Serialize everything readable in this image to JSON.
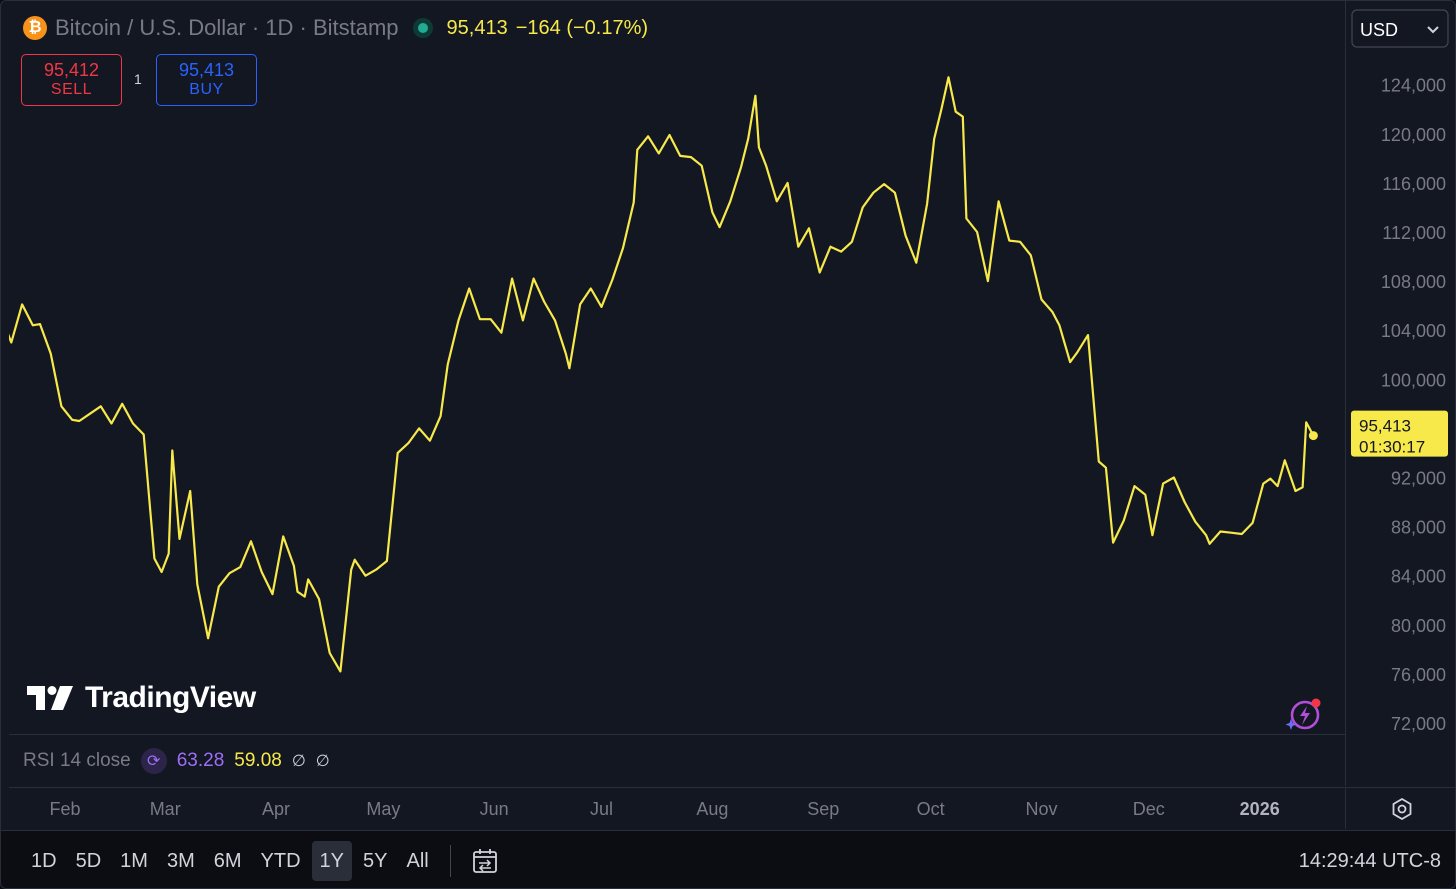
{
  "header": {
    "symbol_icon": "bitcoin-icon",
    "title": "Bitcoin / U.S. Dollar · 1D · Bitstamp",
    "last_price": "95,413",
    "change": "−164 (−0.17%)"
  },
  "trade": {
    "sell_price": "95,412",
    "sell_label": "SELL",
    "spread": "1",
    "buy_price": "95,413",
    "buy_label": "BUY"
  },
  "currency_select": {
    "value": "USD",
    "options": [
      "USD"
    ]
  },
  "price_badge": {
    "price": "95,413",
    "countdown": "01:30:17"
  },
  "brand": {
    "name": "TradingView"
  },
  "rsi": {
    "label": "RSI 14 close",
    "value1": "63.28",
    "value2": "59.08",
    "null1": "∅",
    "null2": "∅"
  },
  "time_axis": {
    "labels": [
      "Feb",
      "Mar",
      "Apr",
      "May",
      "Jun",
      "Jul",
      "Aug",
      "Sep",
      "Oct",
      "Nov",
      "Dec",
      "2026"
    ]
  },
  "bottom_bar": {
    "ranges": [
      "1D",
      "5D",
      "1M",
      "3M",
      "6M",
      "YTD",
      "1Y",
      "5Y",
      "All"
    ],
    "active_range": "1Y",
    "clock": "14:29:44 UTC-8"
  },
  "colors": {
    "line": "#f7e94a",
    "sell": "#f23645",
    "buy": "#2962ff",
    "rsi_primary": "#9c6ff5",
    "background": "#131722"
  },
  "chart_data": {
    "type": "line",
    "title": "Bitcoin / U.S. Dollar · 1D · Bitstamp",
    "xlabel": "",
    "ylabel": "",
    "ylim": [
      70000,
      128500
    ],
    "yticks": [
      72000,
      76000,
      80000,
      84000,
      88000,
      92000,
      100000,
      104000,
      108000,
      112000,
      116000,
      120000,
      124000
    ],
    "ytick_labels": [
      "72,000",
      "76,000",
      "80,000",
      "84,000",
      "88,000",
      "92,000",
      "100,000",
      "104,000",
      "108,000",
      "112,000",
      "116,000",
      "120,000",
      "124,000"
    ],
    "x_axis_dates": [
      "2025-02-01",
      "2025-03-01",
      "2025-04-01",
      "2025-05-01",
      "2025-06-01",
      "2025-07-01",
      "2025-08-01",
      "2025-09-01",
      "2025-10-01",
      "2025-11-01",
      "2025-12-01",
      "2026-01-01"
    ],
    "series": [
      {
        "x": [
          "2025-01-14",
          "2025-01-15",
          "2025-01-17",
          "2025-01-20",
          "2025-01-23",
          "2025-01-25",
          "2025-01-28",
          "2025-01-31",
          "2025-02-03",
          "2025-02-05",
          "2025-02-08",
          "2025-02-11",
          "2025-02-14",
          "2025-02-17",
          "2025-02-20",
          "2025-02-23",
          "2025-02-26",
          "2025-02-28",
          "2025-03-02",
          "2025-03-03",
          "2025-03-05",
          "2025-03-08",
          "2025-03-10",
          "2025-03-13",
          "2025-03-16",
          "2025-03-19",
          "2025-03-22",
          "2025-03-25",
          "2025-03-28",
          "2025-03-31",
          "2025-04-03",
          "2025-04-06",
          "2025-04-07",
          "2025-04-09",
          "2025-04-10",
          "2025-04-13",
          "2025-04-16",
          "2025-04-19",
          "2025-04-22",
          "2025-04-23",
          "2025-04-26",
          "2025-04-29",
          "2025-05-02",
          "2025-05-05",
          "2025-05-08",
          "2025-05-11",
          "2025-05-14",
          "2025-05-17",
          "2025-05-19",
          "2025-05-22",
          "2025-05-25",
          "2025-05-28",
          "2025-05-31",
          "2025-06-03",
          "2025-06-06",
          "2025-06-09",
          "2025-06-12",
          "2025-06-15",
          "2025-06-18",
          "2025-06-21",
          "2025-06-22",
          "2025-06-25",
          "2025-06-28",
          "2025-07-01",
          "2025-07-04",
          "2025-07-07",
          "2025-07-10",
          "2025-07-11",
          "2025-07-14",
          "2025-07-17",
          "2025-07-20",
          "2025-07-23",
          "2025-07-26",
          "2025-07-29",
          "2025-08-01",
          "2025-08-03",
          "2025-08-06",
          "2025-08-09",
          "2025-08-11",
          "2025-08-13",
          "2025-08-14",
          "2025-08-16",
          "2025-08-19",
          "2025-08-22",
          "2025-08-25",
          "2025-08-28",
          "2025-08-31",
          "2025-09-03",
          "2025-09-06",
          "2025-09-09",
          "2025-09-12",
          "2025-09-15",
          "2025-09-18",
          "2025-09-21",
          "2025-09-24",
          "2025-09-27",
          "2025-09-30",
          "2025-10-02",
          "2025-10-04",
          "2025-10-06",
          "2025-10-08",
          "2025-10-10",
          "2025-10-11",
          "2025-10-14",
          "2025-10-17",
          "2025-10-20",
          "2025-10-23",
          "2025-10-26",
          "2025-10-29",
          "2025-11-01",
          "2025-11-04",
          "2025-11-06",
          "2025-11-09",
          "2025-11-11",
          "2025-11-14",
          "2025-11-17",
          "2025-11-19",
          "2025-11-21",
          "2025-11-24",
          "2025-11-27",
          "2025-11-30",
          "2025-12-02",
          "2025-12-05",
          "2025-12-08",
          "2025-12-11",
          "2025-12-14",
          "2025-12-17",
          "2025-12-18",
          "2025-12-21",
          "2025-12-24",
          "2025-12-27",
          "2025-12-30",
          "2026-01-02",
          "2026-01-04",
          "2026-01-06",
          "2026-01-08",
          "2026-01-11",
          "2026-01-13",
          "2026-01-14",
          "2026-01-16"
        ],
        "y": [
          99600,
          104500,
          103000,
          106100,
          104400,
          104500,
          102100,
          97800,
          96700,
          96600,
          97200,
          97800,
          96400,
          98000,
          96400,
          95500,
          85400,
          84300,
          85800,
          94200,
          87000,
          90900,
          83300,
          78900,
          83100,
          84200,
          84700,
          86800,
          84300,
          82500,
          87200,
          84800,
          82700,
          82300,
          83700,
          82100,
          77700,
          76200,
          84500,
          85300,
          84000,
          84500,
          85200,
          94000,
          94800,
          96000,
          95000,
          97000,
          101200,
          104800,
          107400,
          104900,
          104900,
          103800,
          108200,
          104800,
          108200,
          106300,
          104800,
          102100,
          100900,
          106100,
          107400,
          105900,
          108100,
          110700,
          114400,
          118700,
          119800,
          118400,
          119900,
          118200,
          118100,
          117400,
          113600,
          112400,
          114500,
          117300,
          119600,
          123100,
          118900,
          117400,
          114500,
          116000,
          110800,
          112300,
          108700,
          110800,
          110400,
          111200,
          114000,
          115200,
          115900,
          115200,
          111700,
          109500,
          114300,
          119600,
          122000,
          124600,
          121800,
          121400,
          113100,
          112000,
          108000,
          114500,
          111300,
          111200,
          110100,
          106500,
          105500,
          104400,
          101400,
          102200,
          103600,
          93300,
          92800,
          86700,
          88500,
          91300,
          90600,
          87300,
          91500,
          92000,
          90000,
          88400,
          87300,
          86600,
          87600,
          87500,
          87400,
          88300,
          91500,
          91900,
          91300,
          93400,
          90900,
          91200,
          96500,
          95413
        ]
      }
    ],
    "last": {
      "price": 95413,
      "countdown": "01:30:17"
    }
  }
}
